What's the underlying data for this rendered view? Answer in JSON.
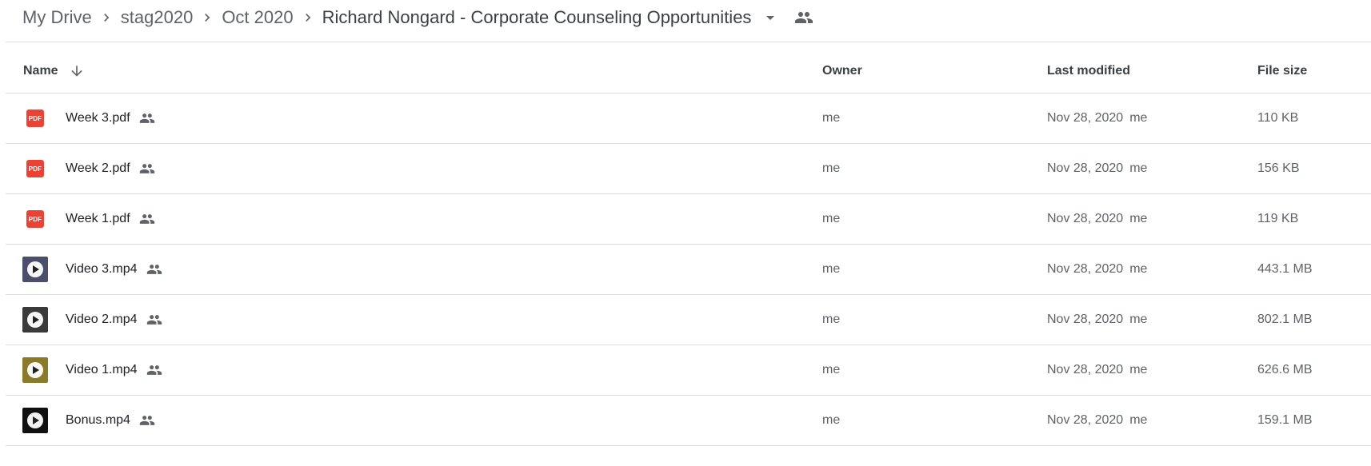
{
  "breadcrumb": {
    "items": [
      {
        "label": "My Drive"
      },
      {
        "label": "stag2020"
      },
      {
        "label": "Oct 2020"
      },
      {
        "label": "Richard Nongard - Corporate Counseling Opportunities"
      }
    ],
    "icons": {
      "separator": "chevron-right-icon",
      "dropdown": "arrow-drop-down-icon",
      "shared": "people-icon"
    }
  },
  "table": {
    "columns": {
      "name": "Name",
      "owner": "Owner",
      "last_modified": "Last modified",
      "file_size": "File size"
    },
    "sort": {
      "column": "name",
      "direction": "descending",
      "icon": "arrow-down-icon"
    },
    "rows": [
      {
        "name": "Week 3.pdf",
        "type": "pdf",
        "type_label": "PDF",
        "shared": true,
        "owner": "me",
        "modified_date": "Nov 28, 2020",
        "modified_by": "me",
        "size": "110 KB"
      },
      {
        "name": "Week 2.pdf",
        "type": "pdf",
        "type_label": "PDF",
        "shared": true,
        "owner": "me",
        "modified_date": "Nov 28, 2020",
        "modified_by": "me",
        "size": "156 KB"
      },
      {
        "name": "Week 1.pdf",
        "type": "pdf",
        "type_label": "PDF",
        "shared": true,
        "owner": "me",
        "modified_date": "Nov 28, 2020",
        "modified_by": "me",
        "size": "119 KB"
      },
      {
        "name": "Video 3.mp4",
        "type": "video",
        "shared": true,
        "owner": "me",
        "modified_date": "Nov 28, 2020",
        "modified_by": "me",
        "size": "443.1 MB",
        "thumb_color": "#4a4e6a"
      },
      {
        "name": "Video 2.mp4",
        "type": "video",
        "shared": true,
        "owner": "me",
        "modified_date": "Nov 28, 2020",
        "modified_by": "me",
        "size": "802.1 MB",
        "thumb_color": "#3a3a3a"
      },
      {
        "name": "Video 1.mp4",
        "type": "video",
        "shared": true,
        "owner": "me",
        "modified_date": "Nov 28, 2020",
        "modified_by": "me",
        "size": "626.6 MB",
        "thumb_color": "#8a7a2a"
      },
      {
        "name": "Bonus.mp4",
        "type": "video",
        "shared": true,
        "owner": "me",
        "modified_date": "Nov 28, 2020",
        "modified_by": "me",
        "size": "159.1 MB",
        "thumb_color": "#111111"
      }
    ]
  },
  "colors": {
    "pdf_red": "#ea4335",
    "divider": "#dadce0",
    "secondary_text": "#5f6368"
  }
}
